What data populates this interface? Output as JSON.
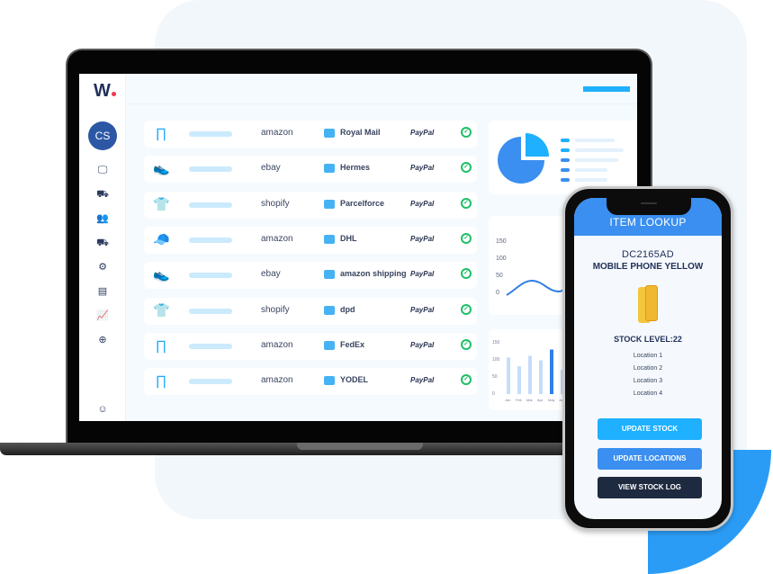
{
  "app": {
    "logo_text": "W",
    "user_initials": "CS"
  },
  "sidebar": {
    "items": [
      {
        "icon": "monitor-icon",
        "glyph": "🖵"
      },
      {
        "icon": "truck-icon",
        "glyph": "⛟"
      },
      {
        "icon": "users-icon",
        "glyph": "👥"
      },
      {
        "icon": "fast-truck-icon",
        "glyph": "⛟"
      },
      {
        "icon": "user-settings-icon",
        "glyph": "⚙"
      },
      {
        "icon": "book-icon",
        "glyph": "▤"
      },
      {
        "icon": "analytics-icon",
        "glyph": "📈"
      },
      {
        "icon": "globe-icon",
        "glyph": "⊕"
      }
    ],
    "bottom": {
      "icon": "account-icon",
      "glyph": "☺"
    }
  },
  "orders": [
    {
      "product": "trousers",
      "glyph": "∏",
      "marketplace": "amazon",
      "carrier": "Royal Mail",
      "payment": "PayPal",
      "status": "complete"
    },
    {
      "product": "sneaker",
      "glyph": "👟",
      "marketplace": "ebay",
      "carrier": "Hermes",
      "payment": "PayPal",
      "status": "complete"
    },
    {
      "product": "t-shirt",
      "glyph": "👕",
      "marketplace": "shopify",
      "carrier": "Parcelforce",
      "payment": "PayPal",
      "status": "complete"
    },
    {
      "product": "cap",
      "glyph": "🧢",
      "marketplace": "amazon",
      "carrier": "DHL",
      "payment": "PayPal",
      "status": "complete"
    },
    {
      "product": "running-shoe",
      "glyph": "👟",
      "marketplace": "ebay",
      "carrier": "amazon shipping",
      "payment": "PayPal",
      "status": "complete"
    },
    {
      "product": "t-shirt",
      "glyph": "👕",
      "marketplace": "shopify",
      "carrier": "dpd",
      "payment": "PayPal",
      "status": "complete"
    },
    {
      "product": "trousers",
      "glyph": "∏",
      "marketplace": "amazon",
      "carrier": "FedEx",
      "payment": "PayPal",
      "status": "complete"
    },
    {
      "product": "trousers",
      "glyph": "∏",
      "marketplace": "amazon",
      "carrier": "YODEL",
      "payment": "PayPal",
      "status": "complete"
    }
  ],
  "line_chart": {
    "y_ticks": [
      "150",
      "100",
      "50",
      "0"
    ]
  },
  "bar_chart": {
    "y_ticks": [
      "150",
      "100",
      "50",
      "0"
    ],
    "categories": [
      "Jan",
      "Feb",
      "Mar",
      "Apr",
      "May",
      "Jun"
    ],
    "values": [
      105,
      80,
      110,
      97,
      128,
      70
    ],
    "highlight_index": 4
  },
  "colors": {
    "accent": "#1fb0ff",
    "primary": "#3a8ff0",
    "dark": "#1e2a40",
    "success": "#1fbf68"
  },
  "phone": {
    "header": "ITEM LOOKUP",
    "sku": "DC2165AD",
    "product_name": "MOBILE PHONE YELLOW",
    "stock_level": "STOCK LEVEL:22",
    "locations": [
      "Location 1",
      "Location 2",
      "Location 3",
      "Location 4"
    ],
    "buttons": {
      "update_stock": "UPDATE STOCK",
      "update_locations": "UPDATE LOCATIONS",
      "view_log": "VIEW STOCK LOG"
    }
  }
}
